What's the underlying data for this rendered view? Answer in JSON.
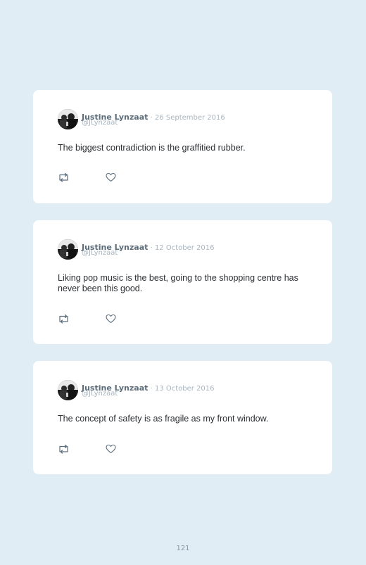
{
  "tweets": [
    {
      "author_name": "Justine Lynzaat",
      "date_text": " · 26 September 2016",
      "handle": "@JLynzaat",
      "text": "The biggest contradiction is the graffitied rubber.",
      "icons": [
        "avatar",
        "retweet-icon",
        "heart-icon"
      ]
    },
    {
      "author_name": "Justine Lynzaat",
      "date_text": " · 12 October 2016",
      "handle": "@JLynzaat",
      "text": "Liking pop music is the best, going to the shopping centre has never been this good.",
      "icons": [
        "avatar",
        "retweet-icon",
        "heart-icon"
      ]
    },
    {
      "author_name": "Justine Lynzaat",
      "date_text": " · 13 October 2016",
      "handle": "@JLynzaat",
      "text": "The concept of safety is as fragile as my front window.",
      "icons": [
        "avatar",
        "retweet-icon",
        "heart-icon"
      ]
    }
  ],
  "page_number": "121",
  "colors": {
    "background": "#e1edf5",
    "card": "#ffffff",
    "name": "#5a6b7a",
    "meta": "#a8b4be",
    "text": "#2c2f33",
    "icon": "#5a6b7a"
  }
}
